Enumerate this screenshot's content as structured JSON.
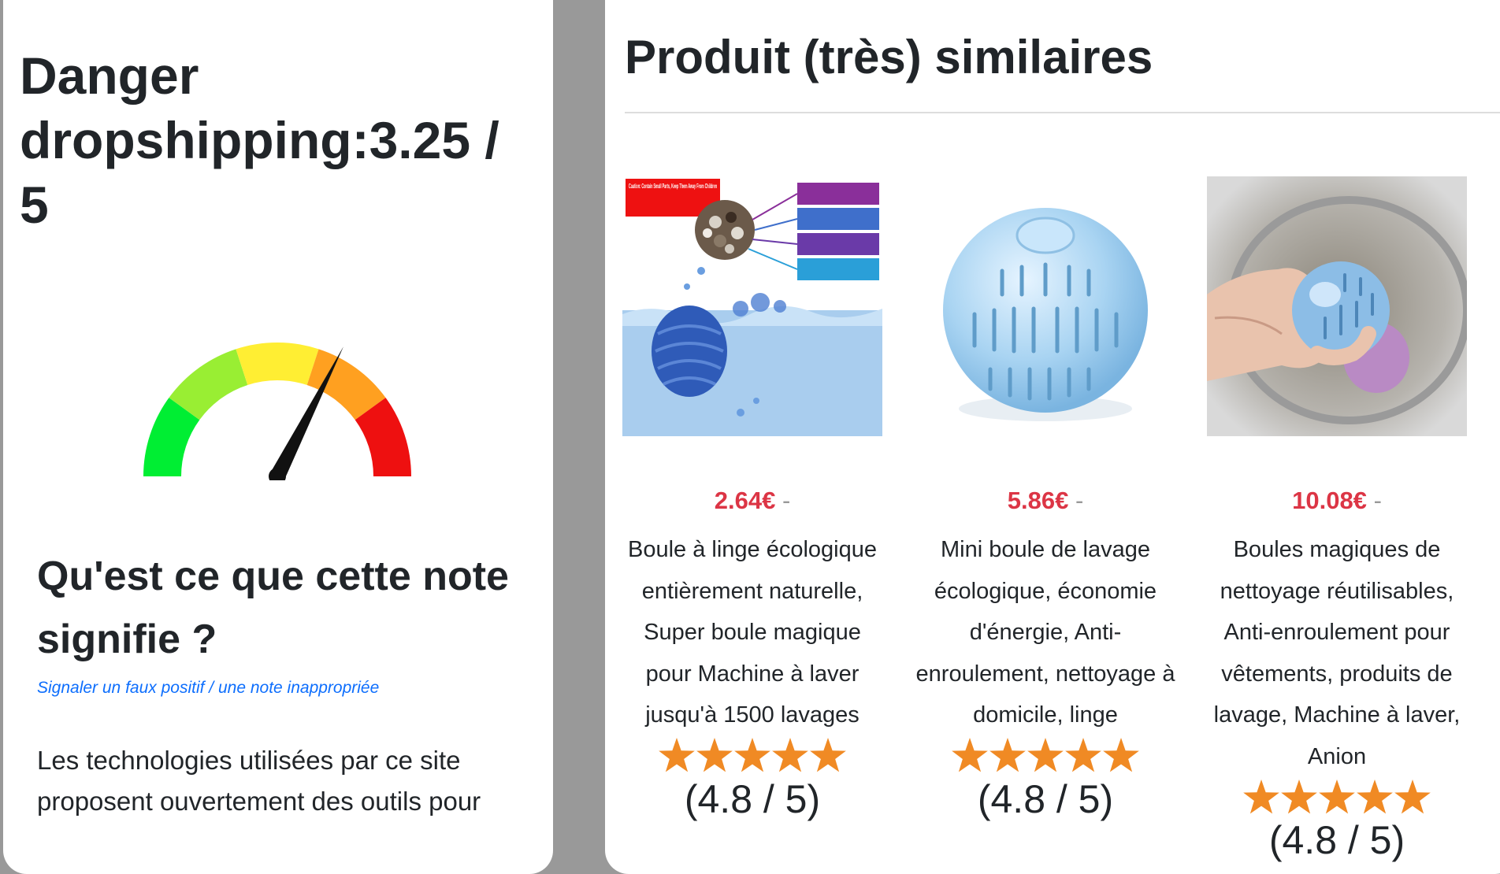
{
  "left_panel": {
    "danger_title": "Danger dropshipping:3.25 / 5",
    "gauge": {
      "value": 3.25,
      "max": 5,
      "segment_colors": [
        "#00ee33",
        "#99ee33",
        "#ffee33",
        "#ffa020",
        "#ee1010"
      ],
      "needle_color": "#111111"
    },
    "meaning_title": "Qu'est ce que cette note signifie ?",
    "report_link": "Signaler un faux positif / une note inappropriée",
    "tech_text": "Les technologies utilisées par ce site proposent ouvertement des outils pour"
  },
  "right_panel": {
    "title": "Produit (très) similaires",
    "products": [
      {
        "price": "2.64€",
        "separator": "-",
        "name": "Boule à linge écologique entièrement naturelle, Super boule magique pour Machine à laver jusqu'à 1500 lavages",
        "rating": "(4.8 / 5)",
        "stars": 5,
        "image_icon": "water-ball-infographic-image",
        "image_caption": "Caution: Contain Small Parts, Keep Them Away From Children"
      },
      {
        "price": "5.86€",
        "separator": "-",
        "name": "Mini boule de lavage écologique, économie d'énergie, Anti-enroulement, nettoyage à domicile, linge",
        "rating": "(4.8 / 5)",
        "stars": 5,
        "image_icon": "blue-laundry-ball-image"
      },
      {
        "price": "10.08€",
        "separator": "-",
        "name": "Boules magiques de nettoyage réutilisables, Anti-enroulement pour vêtements, produits de lavage, Machine à laver, Anion",
        "rating": "(4.8 / 5)",
        "stars": 5,
        "image_icon": "hand-holding-ball-image"
      }
    ],
    "star_color": "#f08a24"
  }
}
